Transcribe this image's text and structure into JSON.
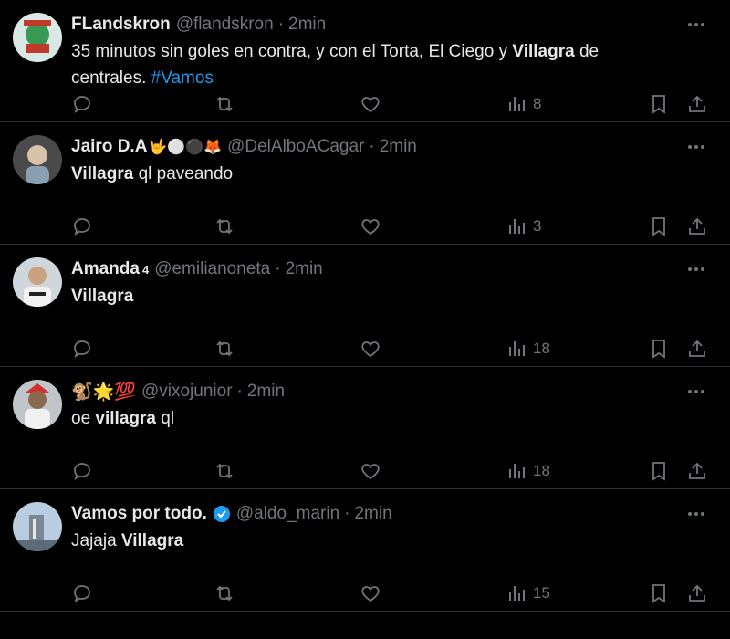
{
  "tweets": [
    {
      "name": "FLandskron",
      "handle": "@flandskron",
      "time": "2min",
      "text_parts": [
        "35 minutos sin goles en contra, y con el Torta, El Ciego y ",
        "Villagra",
        " de centrales. ",
        "#Vamos"
      ],
      "views": "8"
    },
    {
      "name": "Jairo D.A",
      "name_emojis": "🤟⚪⚫🦊",
      "handle": "@DelAlboACagar",
      "time": "2min",
      "text_bold": "Villagra",
      "text_rest": " ql paveando",
      "views": "3"
    },
    {
      "name": "Amanda",
      "name_badge": "4",
      "handle": "@emilianoneta",
      "time": "2min",
      "text_bold": "Villagra",
      "text_rest": "",
      "views": "18"
    },
    {
      "name": "🐒🌟💯",
      "handle": "@vixojunior",
      "time": "2min",
      "text_pre": "oe ",
      "text_bold": "villagra",
      "text_rest": " ql",
      "views": "18"
    },
    {
      "name": "Vamos por todo.",
      "handle": "@aldo_marin",
      "time": "2min",
      "text_pre": "Jajaja ",
      "text_bold": "Villagra",
      "text_rest": "",
      "views": "15"
    }
  ],
  "colors": {
    "background": "#000000",
    "text": "#e7e9ea",
    "secondary": "#71767b",
    "accent": "#1d9bf0",
    "divider": "#2f3336"
  },
  "separator": "·",
  "icons": [
    "reply-icon",
    "retweet-icon",
    "like-icon",
    "views-icon",
    "bookmark-icon",
    "share-icon",
    "more-icon",
    "verified-icon"
  ]
}
